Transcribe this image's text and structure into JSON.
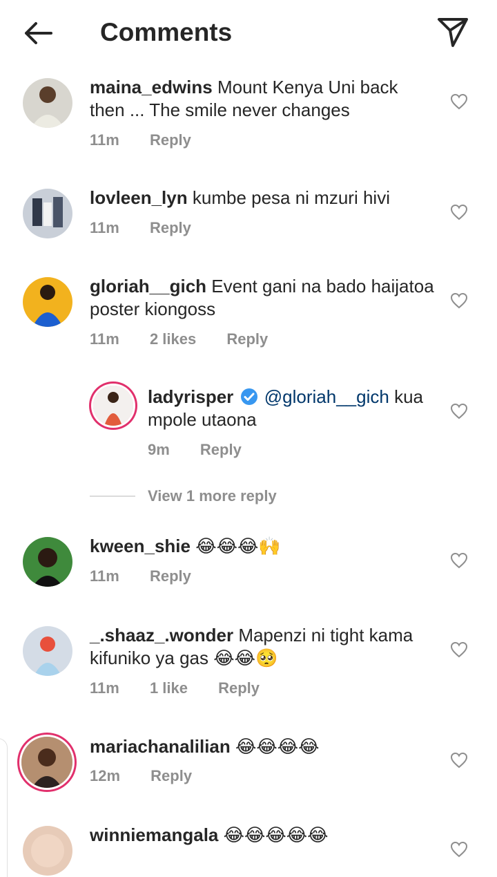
{
  "header": {
    "title": "Comments",
    "back_icon": "arrow-left-icon",
    "share_icon": "paper-plane-icon"
  },
  "colors": {
    "text": "#262626",
    "secondary": "#8e8e8e",
    "mention": "#00376b",
    "verified": "#3897f0",
    "story_ring": "#e1306c"
  },
  "comments": [
    {
      "username": "maina_edwins",
      "text": "Mount Kenya Uni back then ... The smile never changes",
      "time": "11m",
      "likes": "",
      "reply": "Reply",
      "avatar": "avatar-photo"
    },
    {
      "username": "lovleen_lyn",
      "text": "kumbe pesa ni mzuri hivi",
      "time": "11m",
      "likes": "",
      "reply": "Reply",
      "avatar": "avatar-photo"
    },
    {
      "username": "gloriah__gich",
      "text": "Event gani na bado haijatoa poster kiongoss",
      "time": "11m",
      "likes": "2 likes",
      "reply": "Reply",
      "avatar": "avatar-photo"
    },
    {
      "username": "ladyrisper",
      "verified": true,
      "mention": "@gloriah__gich",
      "text": "kua mpole utaona",
      "time": "9m",
      "likes": "",
      "reply": "Reply",
      "avatar": "avatar-photo-with-story-ring"
    },
    {
      "username": "kween_shie",
      "text": "😂😂😂🙌",
      "time": "11m",
      "likes": "",
      "reply": "Reply",
      "avatar": "avatar-photo"
    },
    {
      "username": "_.shaaz_.wonder",
      "text": "Mapenzi ni tight kama kifuniko ya gas 😂😂🥺",
      "time": "11m",
      "likes": "1 like",
      "reply": "Reply",
      "avatar": "avatar-photo"
    },
    {
      "username": "mariachanalilian",
      "text": "😂😂😂😂",
      "time": "12m",
      "likes": "",
      "reply": "Reply",
      "avatar": "avatar-photo-with-story-ring"
    },
    {
      "username": "winniemangala",
      "text": "😂😂😂😂😂",
      "time": "",
      "likes": "",
      "reply": "",
      "avatar": "avatar-photo"
    }
  ],
  "view_more": "View 1 more reply",
  "heart_icon": "heart-outline-icon"
}
